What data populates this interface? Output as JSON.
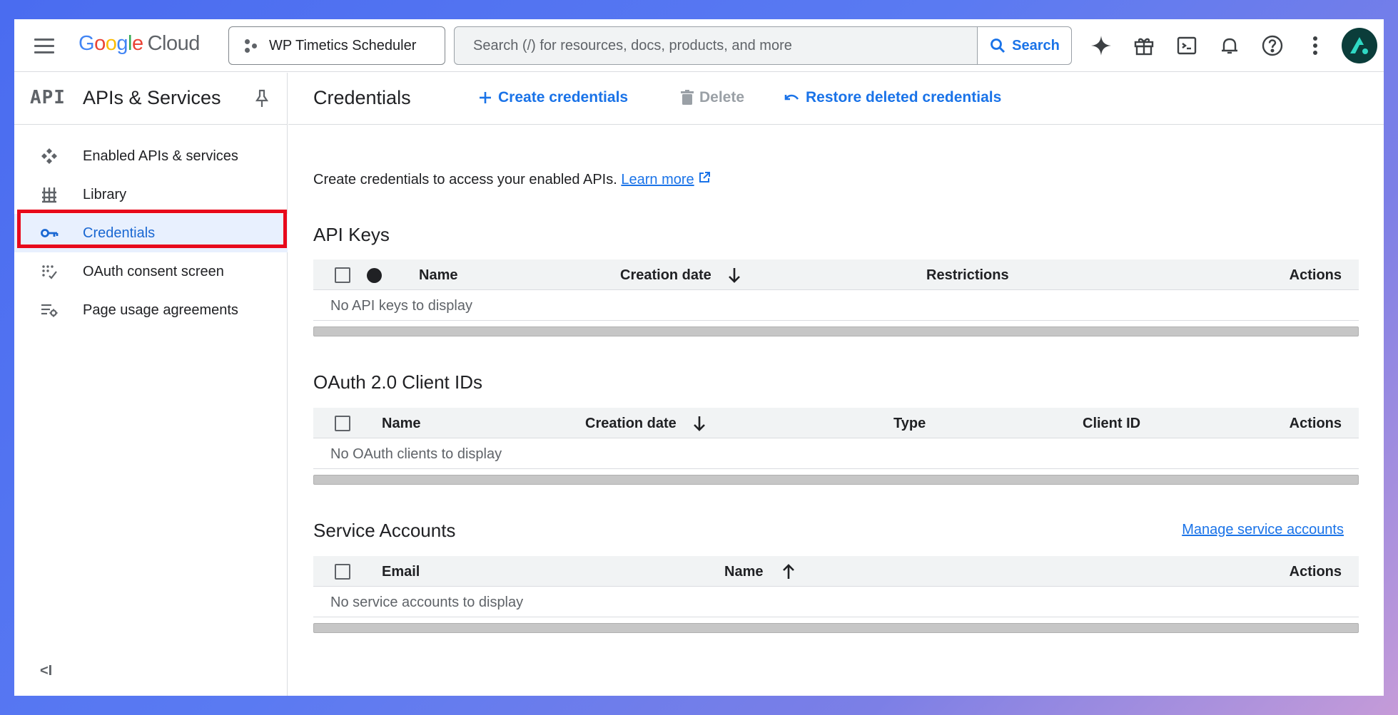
{
  "topbar": {
    "logo_google": [
      "G",
      "o",
      "o",
      "g",
      "l",
      "e"
    ],
    "logo_cloud": "Cloud",
    "project": "WP Timetics Scheduler",
    "search_placeholder": "Search (/) for resources, docs, products, and more",
    "search_button": "Search",
    "icons": [
      "gemini-icon",
      "gift-icon",
      "terminal-icon",
      "bell-icon",
      "help-icon",
      "more-vert-icon"
    ]
  },
  "sidebar": {
    "api_badge": "API",
    "title": "APIs & Services",
    "items": [
      {
        "label": "Enabled APIs & services",
        "icon": "apis-icon"
      },
      {
        "label": "Library",
        "icon": "library-icon"
      },
      {
        "label": "Credentials",
        "icon": "key-icon",
        "active": true
      },
      {
        "label": "OAuth consent screen",
        "icon": "oauth-icon"
      },
      {
        "label": "Page usage agreements",
        "icon": "settings-list-icon"
      }
    ],
    "collapse": "<I"
  },
  "main": {
    "title": "Credentials",
    "create": "Create credentials",
    "delete": "Delete",
    "restore": "Restore deleted credentials",
    "intro": "Create credentials to access your enabled APIs.",
    "learn_more": "Learn more",
    "api_keys": {
      "title": "API Keys",
      "columns": [
        "Name",
        "Creation date",
        "Restrictions",
        "Actions"
      ],
      "empty": "No API keys to display"
    },
    "oauth": {
      "title": "OAuth 2.0 Client IDs",
      "columns": [
        "Name",
        "Creation date",
        "Type",
        "Client ID",
        "Actions"
      ],
      "empty": "No OAuth clients to display"
    },
    "service": {
      "title": "Service Accounts",
      "manage": "Manage service accounts",
      "columns": [
        "Email",
        "Name",
        "Actions"
      ],
      "empty": "No service accounts to display"
    }
  },
  "colors": {
    "accent": "#1a73e8",
    "highlight": "#e8091b",
    "active_bg": "#e8f0fe"
  }
}
